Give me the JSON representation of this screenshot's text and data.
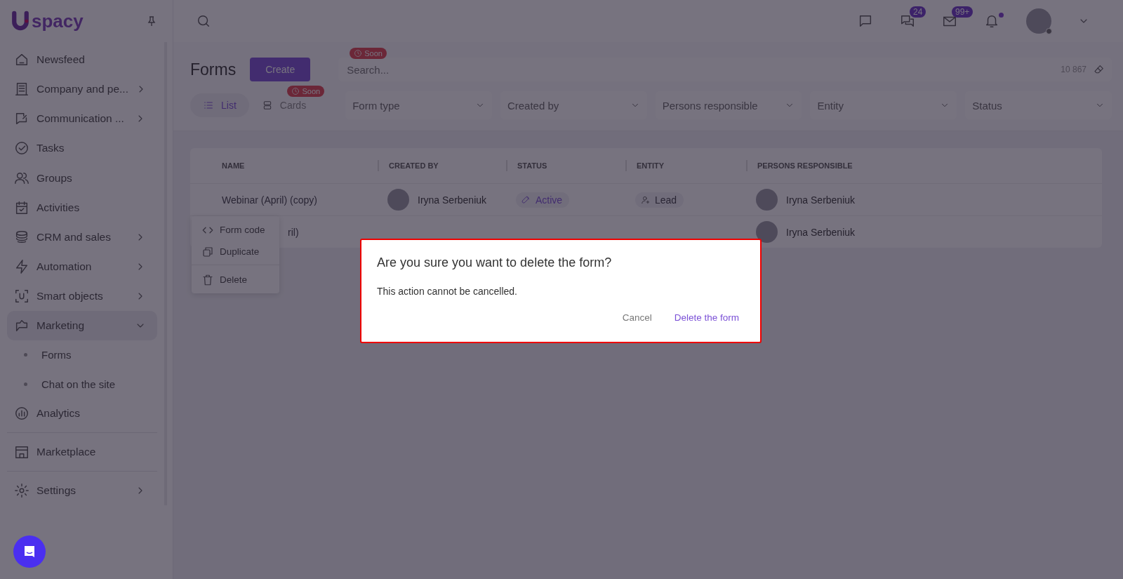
{
  "logo": {
    "text": "spacy"
  },
  "sidebar": {
    "items": [
      {
        "kind": "item",
        "label": "Newsfeed",
        "submenu": false
      },
      {
        "kind": "item",
        "label": "Company and pe...",
        "submenu": true,
        "expanded": false
      },
      {
        "kind": "item",
        "label": "Communication ...",
        "submenu": true,
        "expanded": false
      },
      {
        "kind": "item",
        "label": "Tasks",
        "submenu": false
      },
      {
        "kind": "item",
        "label": "Groups",
        "submenu": false
      },
      {
        "kind": "item",
        "label": "Activities",
        "submenu": false
      },
      {
        "kind": "item",
        "label": "CRM and sales",
        "submenu": true,
        "expanded": false
      },
      {
        "kind": "item",
        "label": "Automation",
        "submenu": true,
        "expanded": false
      },
      {
        "kind": "item",
        "label": "Smart objects",
        "submenu": true,
        "expanded": false
      },
      {
        "kind": "item",
        "label": "Marketing",
        "submenu": true,
        "expanded": true
      },
      {
        "kind": "sub",
        "label": "Forms"
      },
      {
        "kind": "sub",
        "label": "Chat on the site"
      },
      {
        "kind": "item",
        "label": "Analytics",
        "submenu": false
      },
      {
        "kind": "divider"
      },
      {
        "kind": "item",
        "label": "Marketplace",
        "submenu": false
      },
      {
        "kind": "divider"
      },
      {
        "kind": "item",
        "label": "Settings",
        "submenu": true,
        "expanded": false
      }
    ]
  },
  "topbar": {
    "chats_badge": "24",
    "mail_badge": "99+",
    "notifications_unread": true
  },
  "header": {
    "title": "Forms",
    "create": "Create",
    "search": {
      "placeholder": "Search...",
      "badge": "Soon"
    },
    "count": "10 867",
    "views": [
      {
        "label": "List",
        "selected": true
      },
      {
        "label": "Cards",
        "selected": false,
        "badge": "Soon"
      }
    ],
    "filters": [
      "Form type",
      "Created by",
      "Persons responsible",
      "Entity",
      "Status"
    ]
  },
  "table": {
    "columns": [
      "NAME",
      "CREATED BY",
      "STATUS",
      "ENTITY",
      "PERSONS RESPONSIBLE"
    ],
    "rows": [
      {
        "name": "Webinar (April) (copy)",
        "created_by": "Iryna Serbeniuk",
        "status": "Active",
        "entity": "Lead",
        "responsible": "Iryna Serbeniuk"
      },
      {
        "name": "ril)",
        "start_hidden": true,
        "created_by": "",
        "status": "",
        "entity": "",
        "responsible": "Iryna Serbeniuk"
      }
    ]
  },
  "context_menu": [
    {
      "kind": "code",
      "label": "Form code"
    },
    {
      "kind": "copy",
      "label": "Duplicate"
    },
    {
      "kind": "delete",
      "label": "Delete"
    }
  ],
  "dialog": {
    "title": "Are you sure you want to delete the form?",
    "text": "This action cannot be cancelled.",
    "cancel": "Cancel",
    "confirm": "Delete the form"
  }
}
